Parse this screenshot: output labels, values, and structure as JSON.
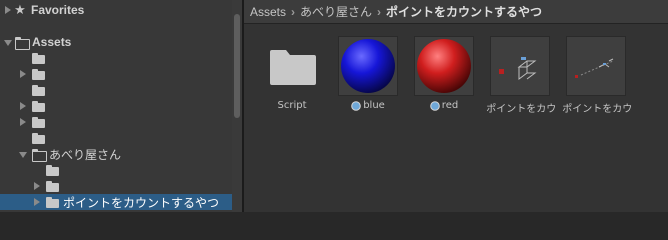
{
  "tree": {
    "favorites_label": "Favorites",
    "assets_label": "Assets",
    "abeya_label": "あべり屋さん",
    "selected_label": "ポイントをカウントするやつ"
  },
  "breadcrumb": {
    "items": [
      "Assets",
      "あべり屋さん",
      "ポイントをカウントするやつ"
    ]
  },
  "assets": [
    {
      "label": "Script",
      "kind": "folder-icon"
    },
    {
      "label": "blue",
      "kind": "material-icon",
      "color": "#1a1ac8"
    },
    {
      "label": "red",
      "kind": "material-icon",
      "color": "#c81a1a"
    },
    {
      "label": "ポイントをカウ...",
      "kind": "prefab-icon"
    },
    {
      "label": "ポイントをカウ...",
      "kind": "prefab-icon"
    }
  ],
  "colors": {
    "selection": "#2c5d87",
    "panel": "#383838",
    "content": "#333333"
  }
}
